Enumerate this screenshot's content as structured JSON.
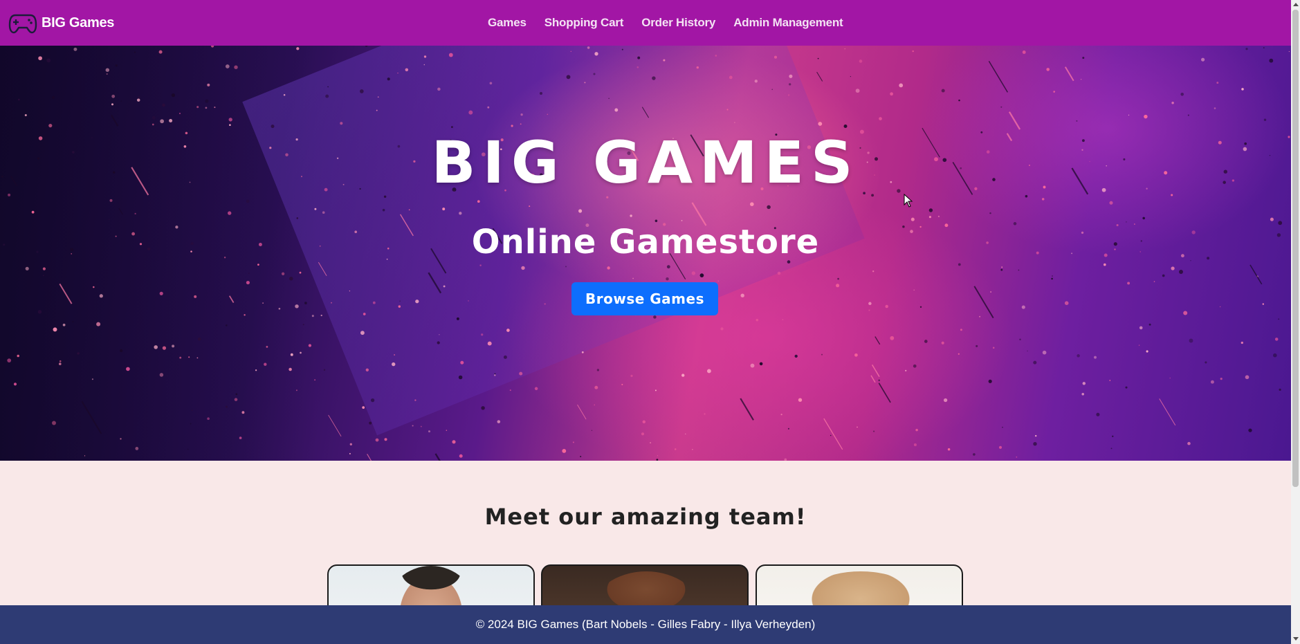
{
  "navbar": {
    "brand_text": "BIG Games",
    "brand_icon": "gamepad-icon",
    "links": [
      {
        "label": "Games"
      },
      {
        "label": "Shopping Cart"
      },
      {
        "label": "Order History"
      },
      {
        "label": "Admin Management"
      }
    ]
  },
  "hero": {
    "title": "BIG GAMES",
    "subtitle": "Online Gamestore",
    "button_label": "Browse Games"
  },
  "team": {
    "heading": "Meet our amazing team!"
  },
  "footer": {
    "text": "© 2024 BIG Games (Bart Nobels - Gilles Fabry - Illya Verheyden)"
  },
  "colors": {
    "navbar_bg": "#a216a5",
    "button_bg": "#0d6efd",
    "footer_bg": "#2e3b74",
    "page_bg": "#f9e8e8"
  }
}
